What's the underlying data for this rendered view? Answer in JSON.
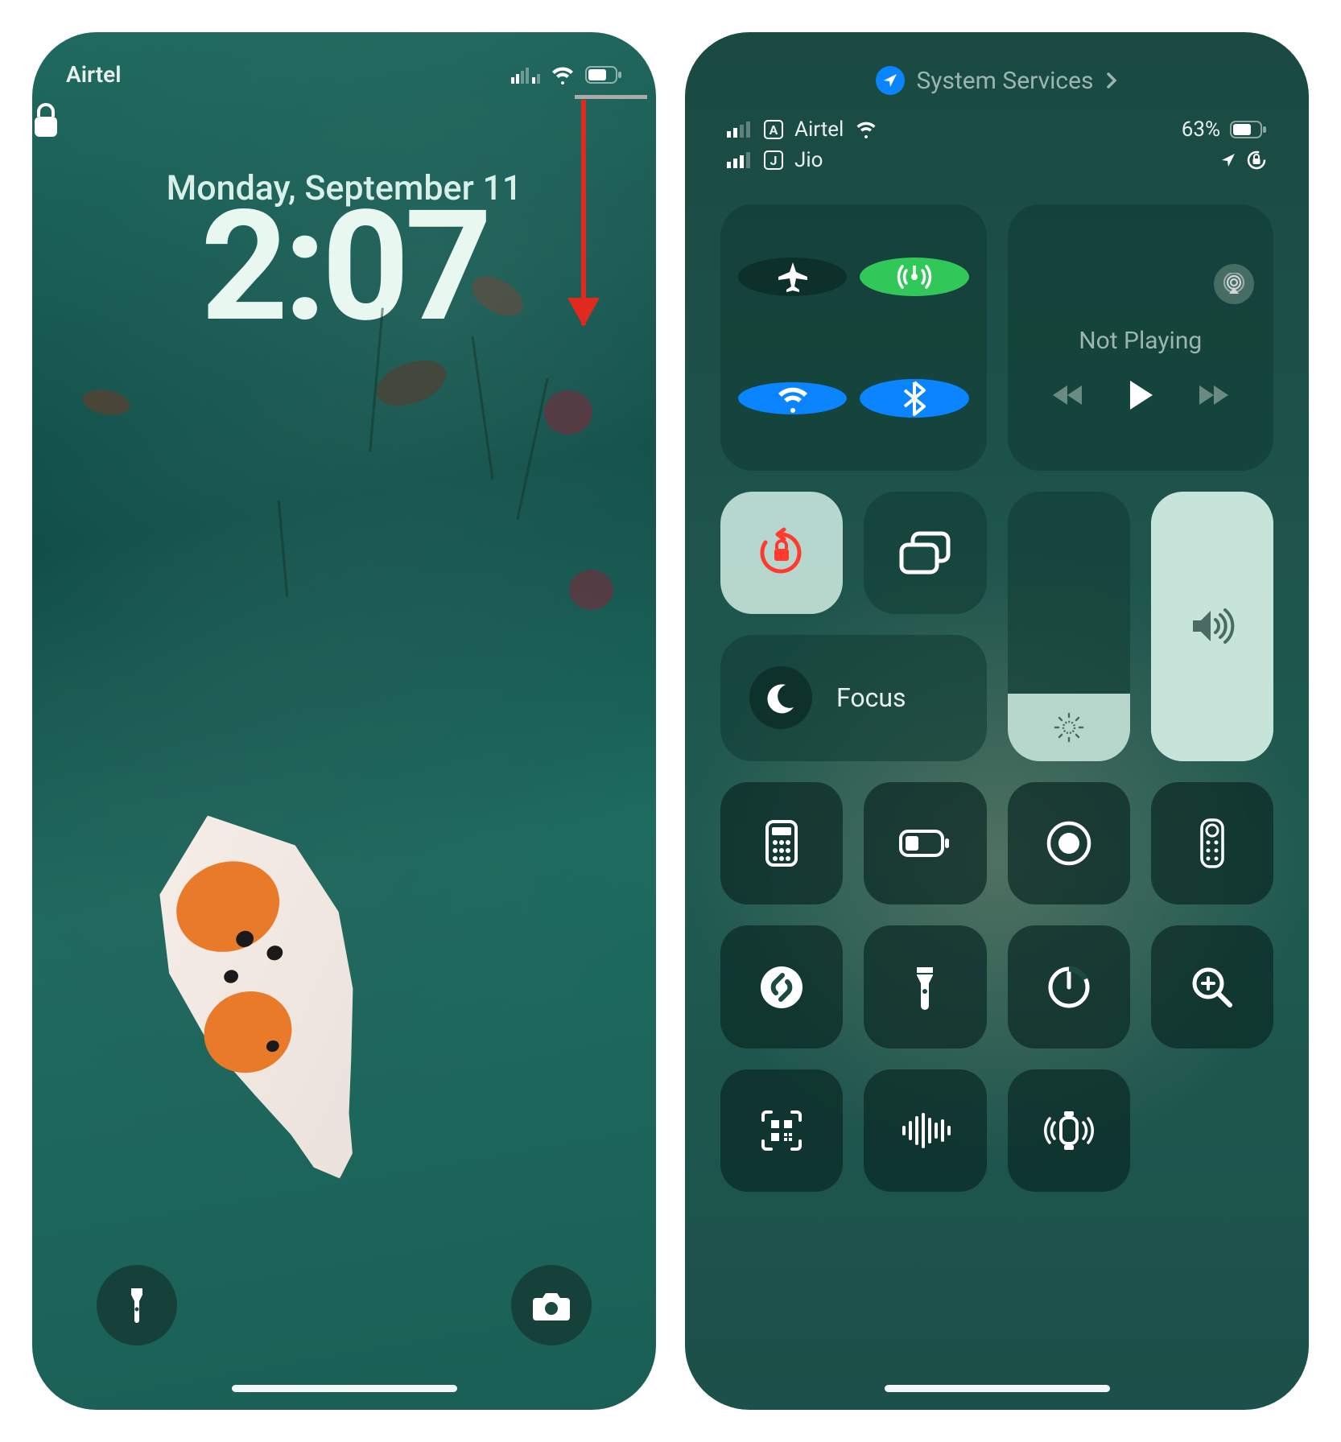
{
  "lock_screen": {
    "carrier": "Airtel",
    "date": "Monday, September 11",
    "time": "2:07"
  },
  "control_center": {
    "top_link": "System Services",
    "sim1": {
      "carrier": "Airtel",
      "letter": "A"
    },
    "sim2": {
      "carrier": "Jio",
      "letter": "J"
    },
    "battery_pct": "63%",
    "media_status": "Not Playing",
    "focus_label": "Focus",
    "toggles": {
      "airplane": false,
      "cellular": true,
      "wifi": true,
      "bluetooth": true,
      "orientation_lock": true
    },
    "brightness_pct": 25,
    "volume_pct": 100
  }
}
